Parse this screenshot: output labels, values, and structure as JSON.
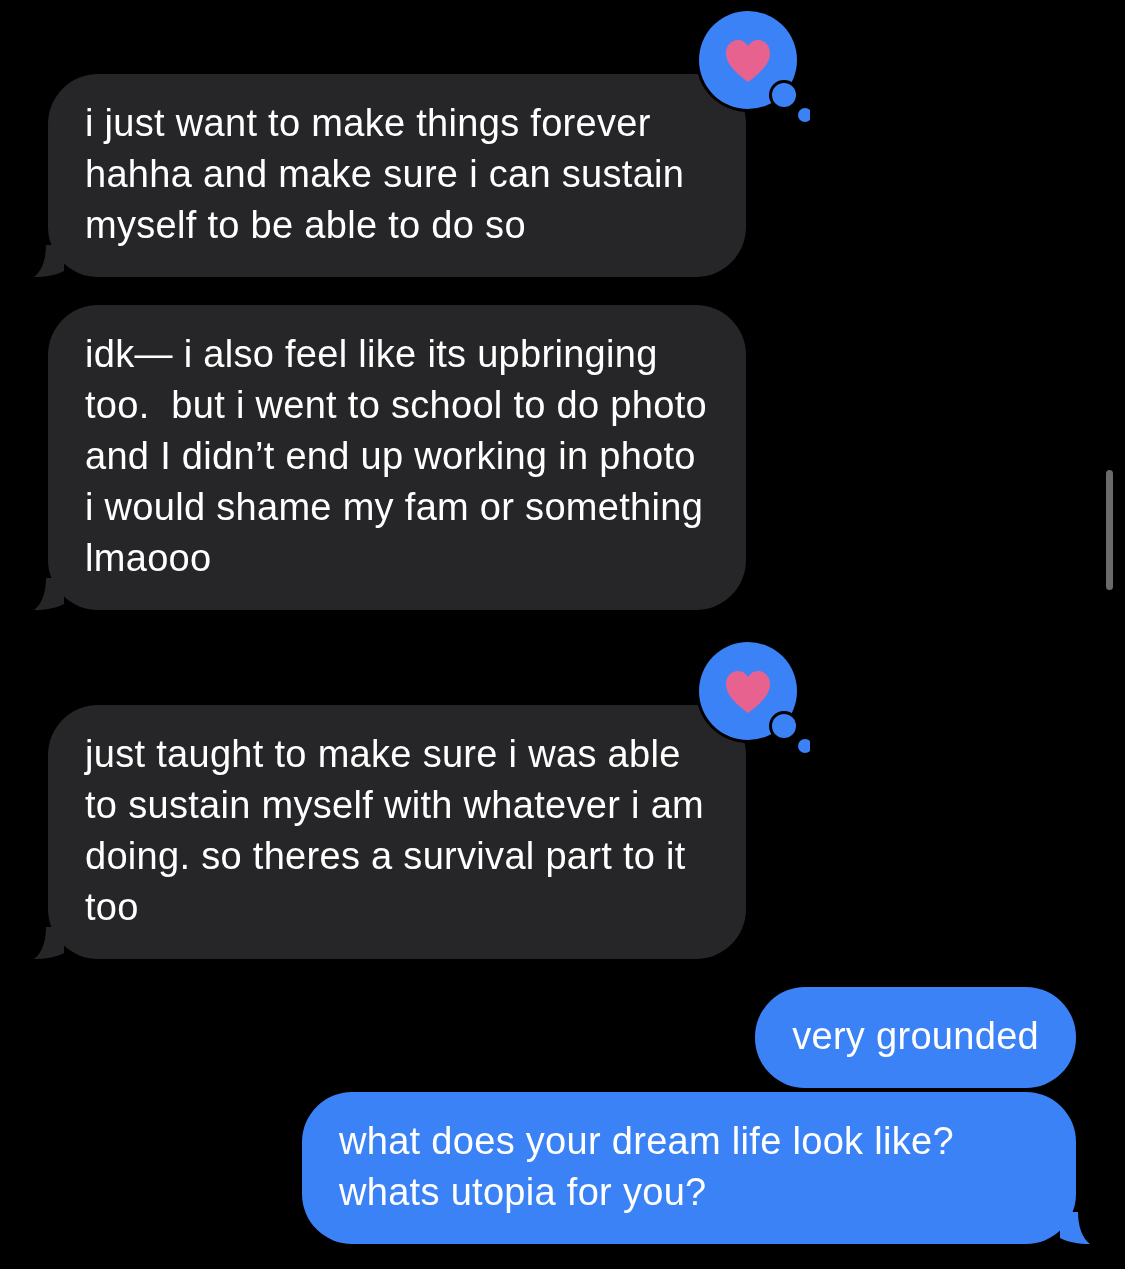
{
  "messages": [
    {
      "sent": false,
      "text": "i just want to make things forever hahha and make sure i can sustain myself to be able to do so",
      "heart": true,
      "tail": true
    },
    {
      "sent": false,
      "text": "idk— i also feel like its upbringing too.  but i went to school to do photo and I didn’t end up working in photo i would shame my fam or something lmaooo",
      "heart": false,
      "tail": true
    },
    {
      "sent": false,
      "text": "just taught to make sure i was able to sustain myself with whatever i am doing. so theres a survival part to it too",
      "heart": true,
      "tail": true
    },
    {
      "sent": true,
      "text": "very grounded",
      "heart": false,
      "tail": false
    },
    {
      "sent": true,
      "text": "what does your dream life look like? whats utopia for you?",
      "heart": false,
      "tail": true
    }
  ]
}
